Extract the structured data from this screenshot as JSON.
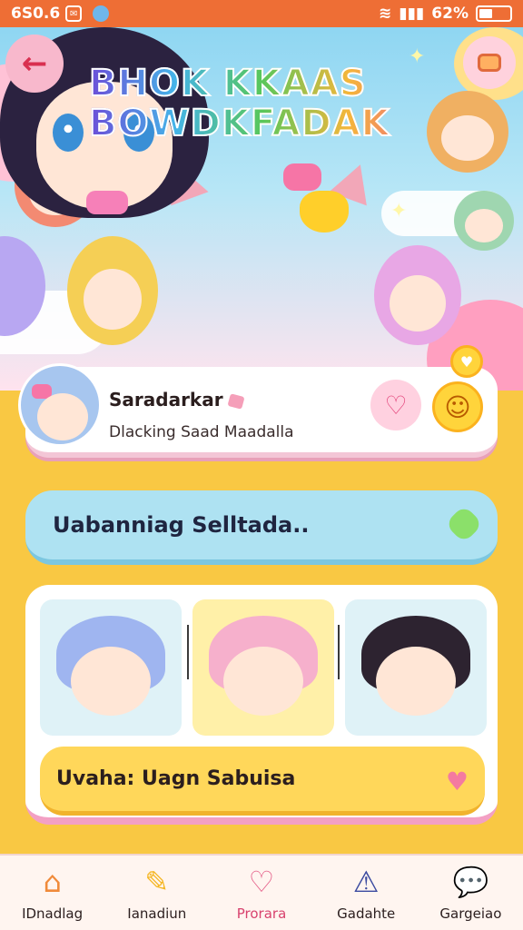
{
  "status_bar": {
    "time": "6S0.6",
    "battery_text": "62%"
  },
  "header": {
    "logo_line1": "BHOK KKAAS",
    "logo_line2": "BOWDKFADAK"
  },
  "profile": {
    "name": "Saradarkar",
    "subtitle": "Dlacking Saad Maadalla"
  },
  "banner": {
    "text": "Uabanniag Selltada.."
  },
  "gallery": {
    "caption": "Uvaha: Uagn Sabuisa"
  },
  "nav": {
    "items": [
      {
        "label": "IDnadlag",
        "icon": "home-icon"
      },
      {
        "label": "Ianadiun",
        "icon": "pencil-icon"
      },
      {
        "label": "Prorara",
        "icon": "heart-search-icon"
      },
      {
        "label": "Gadahte",
        "icon": "warning-icon"
      },
      {
        "label": "Gargeiao",
        "icon": "chat-bubble-icon"
      }
    ]
  }
}
